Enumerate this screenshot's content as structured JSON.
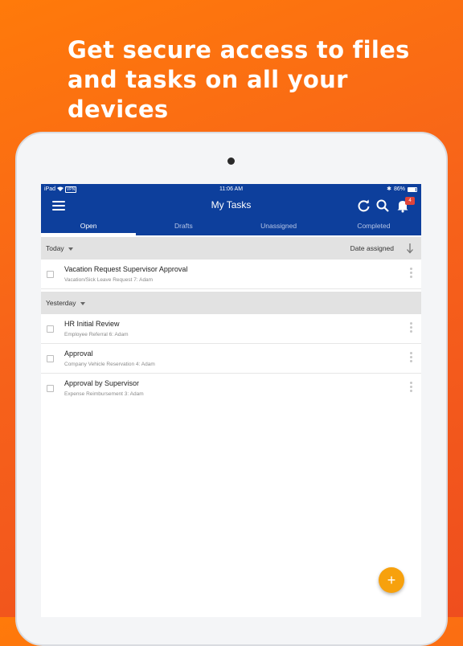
{
  "headline": "Get secure access to files and tasks on all your devices",
  "status": {
    "device": "iPad",
    "vpn": "VPN",
    "time": "11:06 AM",
    "battery": "86%",
    "battery_level": 0.86
  },
  "nav": {
    "title": "My Tasks",
    "notification_count": "4"
  },
  "tabs": [
    {
      "label": "Open",
      "active": true
    },
    {
      "label": "Drafts",
      "active": false
    },
    {
      "label": "Unassigned",
      "active": false
    },
    {
      "label": "Completed",
      "active": false
    }
  ],
  "groups": {
    "today": {
      "label": "Today",
      "sort_label": "Date assigned",
      "tasks": [
        {
          "title": "Vacation Request Supervisor Approval",
          "subtitle": "Vacation/Sick Leave Request 7: Adam"
        }
      ]
    },
    "yesterday": {
      "label": "Yesterday",
      "tasks": [
        {
          "title": "HR Initial Review",
          "subtitle": "Employee Referral 6: Adam"
        },
        {
          "title": "Approval",
          "subtitle": "Company Vehicle Reservation 4: Adam"
        },
        {
          "title": "Approval by Supervisor",
          "subtitle": "Expense Reimbursement 3: Adam"
        }
      ]
    }
  },
  "fab_label": "+",
  "colors": {
    "brand_blue": "#0d3f9c",
    "accent_orange": "#f7a10d",
    "badge_red": "#e0443a"
  }
}
